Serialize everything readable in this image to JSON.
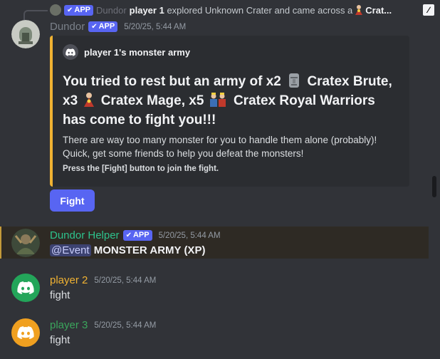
{
  "reply": {
    "author": "Dundor",
    "badge": "APP",
    "bold_name": "player 1",
    "text": "explored Unknown Crater and came across a",
    "trailing": "Crat..."
  },
  "message1": {
    "author": "Dundor",
    "author_color": "#7a8089",
    "badge": "APP",
    "timestamp": "5/20/25, 5:44 AM",
    "embed": {
      "accent": "#f0b232",
      "author": "player 1's monster army",
      "title_parts": [
        "You tried to rest but an army of x2",
        "Cratex Brute, x3",
        "Cratex Mage, x5",
        "Cratex Royal Warriors has come to fight you!!!"
      ],
      "description_line1": "There are way too many monster for you to handle them alone (probably)!",
      "description_line2": "Quick, get some friends to help you defeat the monsters!",
      "footer_note": "Press the [Fight] button to join the fight."
    },
    "button": "Fight"
  },
  "message2": {
    "author": "Dundor Helper",
    "author_color": "#2dc28c",
    "badge": "APP",
    "timestamp": "5/20/25, 5:44 AM",
    "mention": "@Event",
    "text": "MONSTER ARMY (XP)"
  },
  "message3": {
    "author": "player 2",
    "author_color": "#f0b232",
    "timestamp": "5/20/25, 5:44 AM",
    "text": "fight",
    "avatar_color": "#23a55a"
  },
  "message4": {
    "author": "player 3",
    "author_color": "#3ba55c",
    "timestamp": "5/20/25, 5:44 AM",
    "text": "fight",
    "avatar_color": "#f0a020"
  }
}
